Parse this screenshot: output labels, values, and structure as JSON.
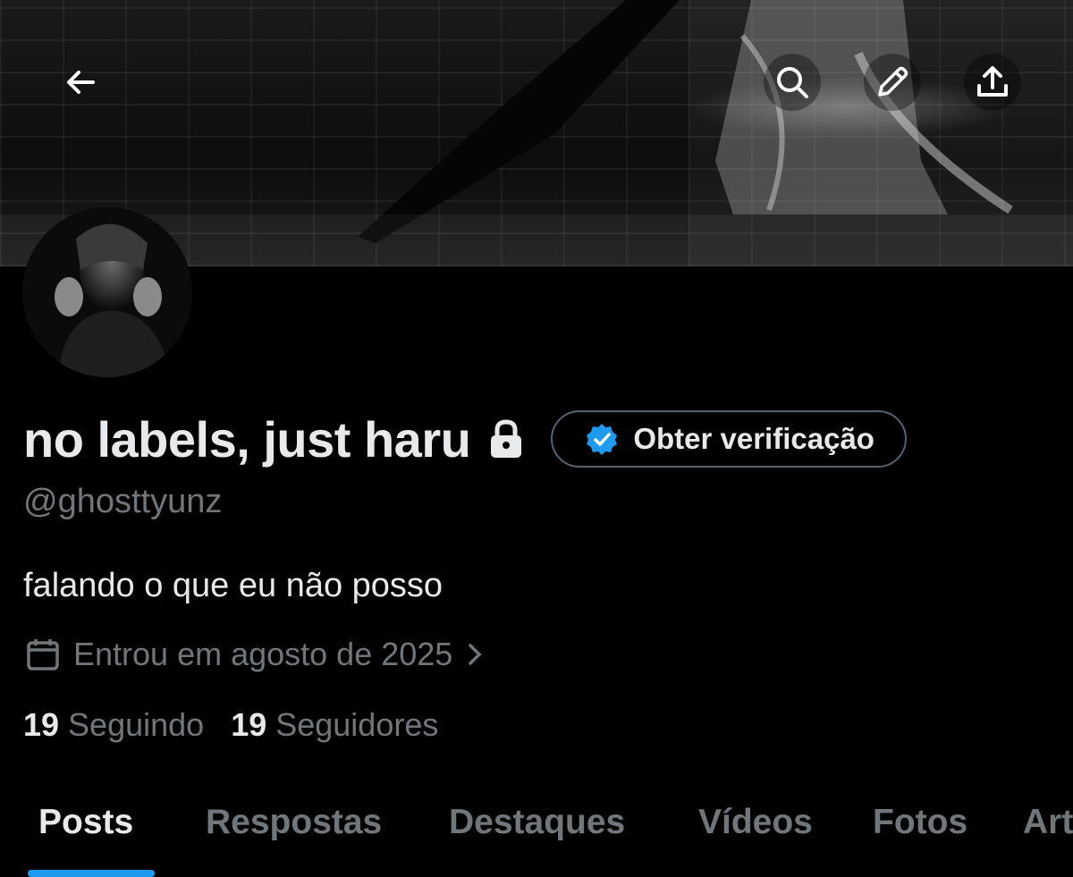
{
  "header": {
    "back_icon": "arrow-left-icon",
    "search_icon": "search-icon",
    "edit_icon": "pencil-icon",
    "share_icon": "share-upload-icon"
  },
  "profile": {
    "display_name": "no labels, just haru",
    "protected_icon": "lock-icon",
    "verify_button_label": "Obter verificação",
    "verify_icon": "verified-badge-icon",
    "handle": "@ghosttyunz",
    "bio": "falando o que eu não posso",
    "joined_icon": "calendar-icon",
    "joined_text": "Entrou em agosto de 2025",
    "following_count": "19",
    "following_label": "Seguindo",
    "followers_count": "19",
    "followers_label": "Seguidores"
  },
  "tabs": [
    {
      "label": "Posts",
      "active": true
    },
    {
      "label": "Respostas",
      "active": false
    },
    {
      "label": "Destaques",
      "active": false
    },
    {
      "label": "Vídeos",
      "active": false
    },
    {
      "label": "Fotos",
      "active": false
    },
    {
      "label": "Artigos",
      "active": false
    }
  ],
  "colors": {
    "background": "#000000",
    "primary_text": "#e7e9ea",
    "secondary_text": "#71767b",
    "accent": "#1d9bf0",
    "button_border": "#536471"
  }
}
